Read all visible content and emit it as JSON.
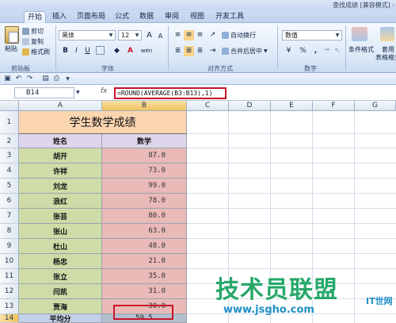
{
  "window": {
    "title": "查找成绩 [兼容模式] - M"
  },
  "tabs": [
    "开始",
    "插入",
    "页面布局",
    "公式",
    "数据",
    "审阅",
    "视图",
    "开发工具"
  ],
  "ribbon": {
    "clipboard": {
      "paste": "粘贴",
      "cut": "剪切",
      "copy": "复制",
      "format_painter": "格式刷",
      "group": "剪贴板"
    },
    "font": {
      "name": "黑体",
      "size": "12",
      "bold": "B",
      "italic": "I",
      "underline": "U",
      "grow": "A",
      "shrink": "A",
      "font_color": "A",
      "phonetic": "wén",
      "group": "字体"
    },
    "alignment": {
      "wrap": "自动换行",
      "merge": "合并后居中",
      "group": "对齐方式"
    },
    "number": {
      "format": "数值",
      "percent": "%",
      "comma": ",",
      "group": "数字"
    },
    "styles": {
      "conditional": "条件格式",
      "apply": "套用",
      "table_format": "表格格式"
    }
  },
  "formula_bar": {
    "name_box": "B14",
    "fx": "fx",
    "formula": "=ROUND(AVERAGE(B3:B13),1)"
  },
  "columns": [
    "A",
    "B",
    "C",
    "D",
    "E",
    "F",
    "G"
  ],
  "rows": [
    "1",
    "2",
    "3",
    "4",
    "5",
    "6",
    "7",
    "8",
    "9",
    "10",
    "11",
    "12",
    "13",
    "14"
  ],
  "sheet": {
    "title": "学生数学成绩",
    "header_name": "姓名",
    "header_score": "数学",
    "students": [
      {
        "name": "胡开",
        "score": "87.0"
      },
      {
        "name": "许祥",
        "score": "73.0"
      },
      {
        "name": "刘龙",
        "score": "99.0"
      },
      {
        "name": "浪红",
        "score": "78.0"
      },
      {
        "name": "张芸",
        "score": "80.0"
      },
      {
        "name": "张山",
        "score": "63.0"
      },
      {
        "name": "杜山",
        "score": "48.0"
      },
      {
        "name": "杨忠",
        "score": "21.0"
      },
      {
        "name": "张立",
        "score": "35.0"
      },
      {
        "name": "闫凯",
        "score": "31.0"
      },
      {
        "name": "贾海",
        "score": "30.0"
      }
    ],
    "avg_label": "平均分",
    "avg_value": "59.5"
  },
  "watermark": {
    "text": "技术员联盟",
    "url": "www.jsgho.com",
    "logo": "IT世网"
  },
  "colors": {
    "title_bg": "#fbd5b0",
    "header_bg": "#ddd5ea",
    "name_bg": "#cfdca7",
    "score_bg": "#e9bab7",
    "highlight": "#c8132b"
  }
}
